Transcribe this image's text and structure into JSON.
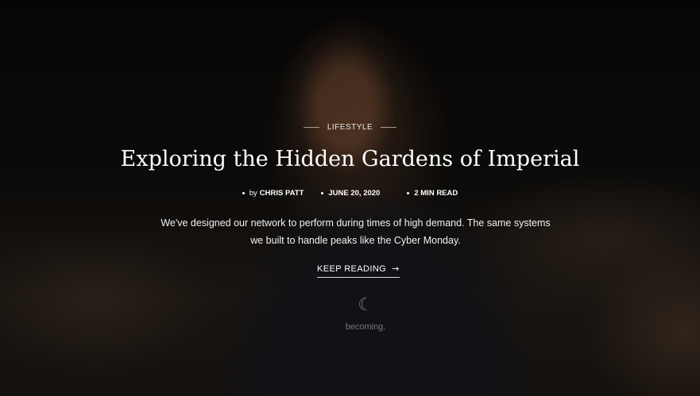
{
  "post": {
    "category": "LIFESTYLE",
    "title": "Exploring the Hidden Gardens of Imperial",
    "meta": {
      "by_label": "by",
      "author": "CHRIS PATT",
      "date": "JUNE 20, 2020",
      "read_time": "2 MIN READ"
    },
    "excerpt_line1": "We've designed our network to perform during times of high demand. The same systems",
    "excerpt_line2": "we built to handle peaks like the Cyber Monday.",
    "cta_label": "KEEP READING",
    "cta_icon": "arrow-right-icon"
  },
  "background": {
    "shirt_logo_icon": "crescent-moon-icon",
    "shirt_text": "becoming."
  }
}
